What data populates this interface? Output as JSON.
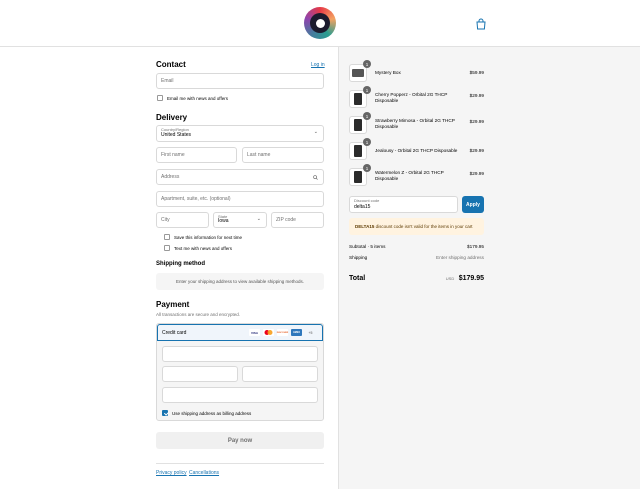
{
  "header": {
    "logo_icon": "store-logo-icon",
    "bag_icon": "shopping-bag-icon"
  },
  "contact": {
    "title": "Contact",
    "login_link": "Log in",
    "email_placeholder": "Email",
    "newsletter_label": "Email me with news and offers"
  },
  "delivery": {
    "title": "Delivery",
    "country_label": "Country/Region",
    "country_value": "United States",
    "first_name_placeholder": "First name",
    "last_name_placeholder": "Last name",
    "address_placeholder": "Address",
    "apartment_placeholder": "Apartment, suite, etc. (optional)",
    "city_placeholder": "City",
    "state_label": "State",
    "state_value": "Iowa",
    "zip_placeholder": "ZIP code",
    "save_info_label": "Save this information for next time",
    "text_me_label": "Text me with news and offers"
  },
  "shipping": {
    "title": "Shipping method",
    "message": "Enter your shipping address to view available shipping methods."
  },
  "payment": {
    "title": "Payment",
    "subtitle": "All transactions are secure and encrypted.",
    "method_label": "Credit card",
    "cards": [
      "VISA",
      "MC",
      "DISCOVER",
      "AMEX",
      "+5"
    ],
    "billing_label": "Use shipping address as billing address",
    "pay_button": "Pay now"
  },
  "footer": {
    "privacy": "Privacy policy",
    "cancellations": "Cancellations"
  },
  "summary": {
    "items": [
      {
        "qty": "1",
        "name": "Mystery Box",
        "price": "$59.99"
      },
      {
        "qty": "1",
        "name": "Cherry Popperz - Orbital 2G THCP Disposable",
        "price": "$29.99"
      },
      {
        "qty": "1",
        "name": "Strawberry Mimosa - Orbital 2G THCP Disposable",
        "price": "$29.99"
      },
      {
        "qty": "1",
        "name": "Jealousy - Orbital 2G THCP Disposable",
        "price": "$29.99"
      },
      {
        "qty": "1",
        "name": "Watermelon Z - Orbital 2G THCP Disposable",
        "price": "$29.99"
      }
    ],
    "discount_label": "Discount code",
    "discount_value": "delta15",
    "apply_button": "Apply",
    "error_code": "DELTA15",
    "error_text": "discount code isn't valid for the items in your cart",
    "subtotal_label": "Subtotal · 5 items",
    "subtotal_value": "$179.95",
    "shipping_label": "Shipping",
    "shipping_value": "Enter shipping address",
    "total_label": "Total",
    "currency": "USD",
    "total_value": "$179.95"
  },
  "colors": {
    "accent": "#1773b0",
    "panel": "#f5f5f5"
  }
}
